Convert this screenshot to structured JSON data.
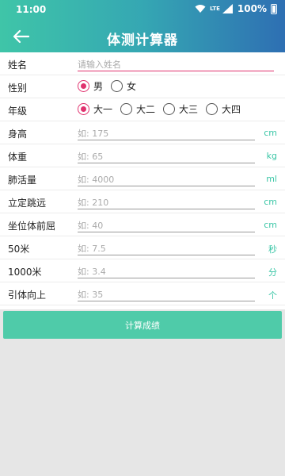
{
  "status_bar": {
    "time": "11:00",
    "network": "LTE",
    "battery": "100%"
  },
  "header": {
    "title": "体测计算器",
    "back_icon": "arrow-left-icon"
  },
  "fields": {
    "name": {
      "label": "姓名",
      "placeholder": "请输入姓名",
      "value": ""
    },
    "gender": {
      "label": "性别",
      "options": [
        "男",
        "女"
      ],
      "selected": "男"
    },
    "grade": {
      "label": "年级",
      "options": [
        "大一",
        "大二",
        "大三",
        "大四"
      ],
      "selected": "大一"
    },
    "height": {
      "label": "身高",
      "placeholder": "如: 175",
      "unit": "cm"
    },
    "weight": {
      "label": "体重",
      "placeholder": "如: 65",
      "unit": "kg"
    },
    "vital_capacity": {
      "label": "肺活量",
      "placeholder": "如: 4000",
      "unit": "ml"
    },
    "long_jump": {
      "label": "立定跳远",
      "placeholder": "如: 210",
      "unit": "cm"
    },
    "sit_reach": {
      "label": "坐位体前屈",
      "placeholder": "如: 40",
      "unit": "cm"
    },
    "run_50": {
      "label": "50米",
      "placeholder": "如: 7.5",
      "unit": "秒"
    },
    "run_1000": {
      "label": "1000米",
      "placeholder": "如: 3.4",
      "unit": "分"
    },
    "pullups": {
      "label": "引体向上",
      "placeholder": "如: 35",
      "unit": "个"
    }
  },
  "button": {
    "label": "计算成绩"
  },
  "colors": {
    "accent": "#3ac6a6",
    "radio_selected": "#e0336f",
    "header_start": "#3fc5a8",
    "header_end": "#2e6fb3"
  }
}
